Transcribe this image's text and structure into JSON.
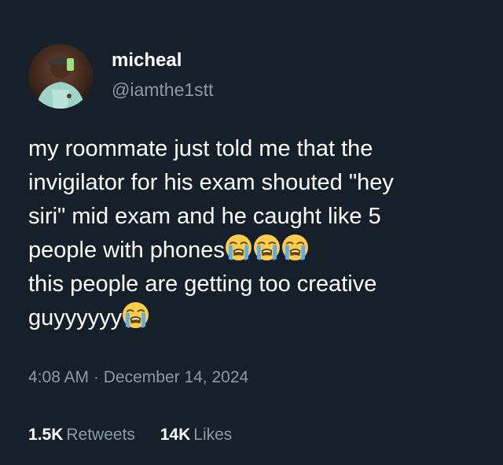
{
  "author": {
    "display_name": "micheal",
    "handle": "@iamthe1stt"
  },
  "tweet": {
    "lines": [
      "my roommate just told me that the",
      "invigilator for his exam shouted \"hey",
      "siri\" mid exam and he caught like 5",
      "people with phones",
      "this people are getting too creative",
      "guyyyyyy"
    ],
    "emoji_name": "loudly-crying-face"
  },
  "meta": {
    "time": "4:08 AM",
    "separator": "·",
    "date": "December 14, 2024"
  },
  "stats": {
    "retweets_count": "1.5K",
    "retweets_label": "Retweets",
    "likes_count": "14K",
    "likes_label": "Likes"
  },
  "colors": {
    "background": "#15202b",
    "text_primary": "#ffffff",
    "text_secondary": "#8b98a5"
  }
}
